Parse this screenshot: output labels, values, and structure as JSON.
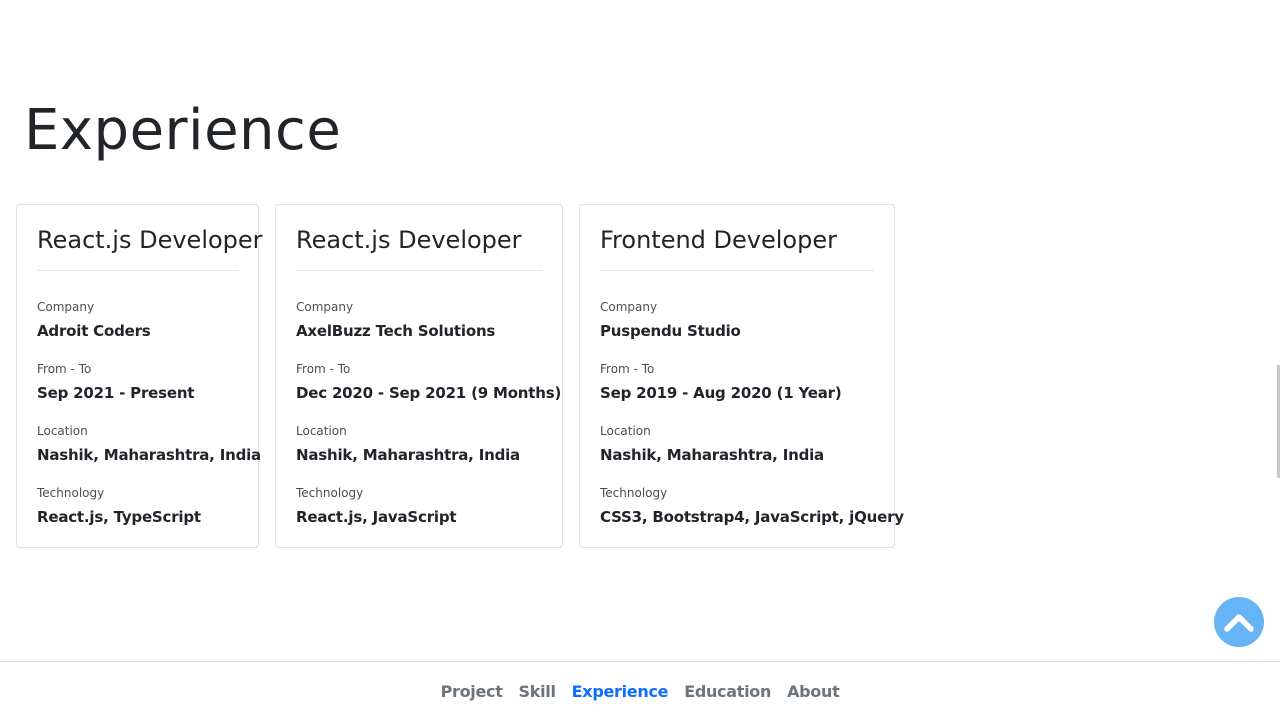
{
  "section": {
    "title": "Experience"
  },
  "experience": [
    {
      "title": "React.js Developer",
      "company_label": "Company",
      "company": "Adroit Coders",
      "period_label": "From - To",
      "period": "Sep 2021 - Present",
      "location_label": "Location",
      "location": "Nashik, Maharashtra, India",
      "technology_label": "Technology",
      "technology": "React.js, TypeScript"
    },
    {
      "title": "React.js Developer",
      "company_label": "Company",
      "company": "AxelBuzz Tech Solutions",
      "period_label": "From - To",
      "period": "Dec 2020 - Sep 2021 (9 Months)",
      "location_label": "Location",
      "location": "Nashik, Maharashtra, India",
      "technology_label": "Technology",
      "technology": "React.js, JavaScript"
    },
    {
      "title": "Frontend Developer",
      "company_label": "Company",
      "company": "Puspendu Studio",
      "period_label": "From - To",
      "period": "Sep 2019 - Aug 2020 (1 Year)",
      "location_label": "Location",
      "location": "Nashik, Maharashtra, India",
      "technology_label": "Technology",
      "technology": "CSS3, Bootstrap4, JavaScript, jQuery"
    }
  ],
  "scroll_top": {
    "icon": "chevron-up-icon",
    "color": "#66b3f6"
  },
  "nav": {
    "items": [
      "Project",
      "Skill",
      "Experience",
      "Education",
      "About"
    ],
    "active": "Experience",
    "active_color": "#0d6efd"
  }
}
